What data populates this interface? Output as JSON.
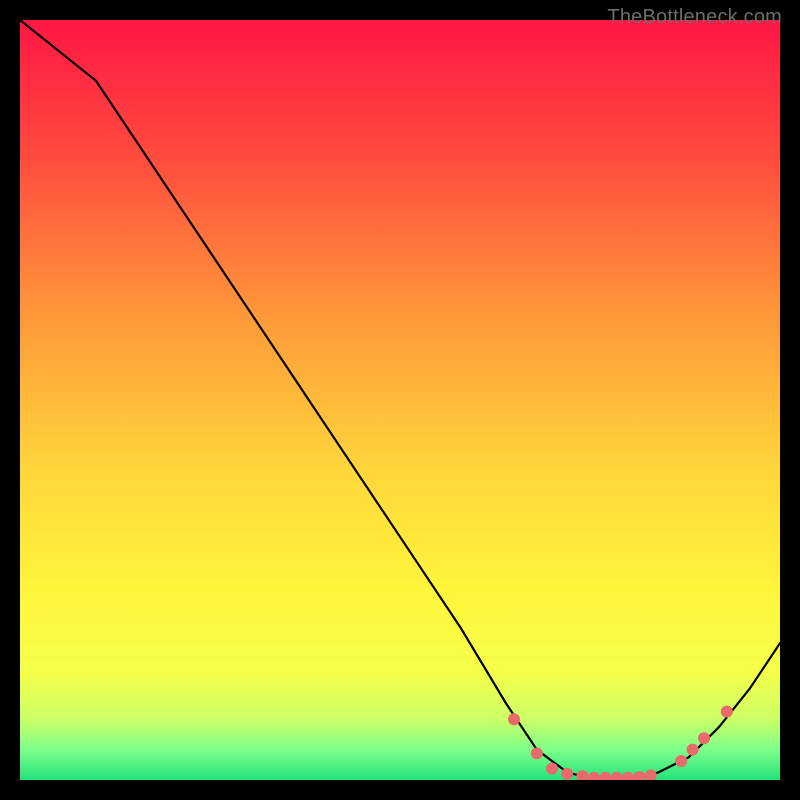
{
  "watermark": "TheBottleneck.com",
  "chart_data": {
    "type": "line",
    "title": "",
    "xlabel": "",
    "ylabel": "",
    "xlim": [
      0,
      100
    ],
    "ylim": [
      0,
      100
    ],
    "gradient_stops": [
      {
        "offset": 0,
        "color": "#ff1744"
      },
      {
        "offset": 18,
        "color": "#ff4b3e"
      },
      {
        "offset": 40,
        "color": "#ff9c3a"
      },
      {
        "offset": 60,
        "color": "#ffd83b"
      },
      {
        "offset": 75,
        "color": "#fff53b"
      },
      {
        "offset": 86,
        "color": "#f4ff4a"
      },
      {
        "offset": 92,
        "color": "#ccff66"
      },
      {
        "offset": 96,
        "color": "#7dff8a"
      },
      {
        "offset": 100,
        "color": "#23e27a"
      }
    ],
    "curve": [
      {
        "x": 0,
        "y": 100
      },
      {
        "x": 10,
        "y": 92
      },
      {
        "x": 20,
        "y": 77
      },
      {
        "x": 30,
        "y": 62
      },
      {
        "x": 40,
        "y": 47
      },
      {
        "x": 50,
        "y": 32
      },
      {
        "x": 58,
        "y": 20
      },
      {
        "x": 64,
        "y": 10
      },
      {
        "x": 68,
        "y": 4
      },
      {
        "x": 72,
        "y": 1
      },
      {
        "x": 76,
        "y": 0
      },
      {
        "x": 80,
        "y": 0
      },
      {
        "x": 84,
        "y": 1
      },
      {
        "x": 88,
        "y": 3
      },
      {
        "x": 92,
        "y": 7
      },
      {
        "x": 96,
        "y": 12
      },
      {
        "x": 100,
        "y": 18
      }
    ],
    "markers": [
      {
        "x": 65,
        "y": 8
      },
      {
        "x": 68,
        "y": 3.5
      },
      {
        "x": 70,
        "y": 1.5
      },
      {
        "x": 72,
        "y": 0.8
      },
      {
        "x": 74,
        "y": 0.5
      },
      {
        "x": 75.5,
        "y": 0.3
      },
      {
        "x": 77,
        "y": 0.3
      },
      {
        "x": 78.5,
        "y": 0.3
      },
      {
        "x": 80,
        "y": 0.3
      },
      {
        "x": 81.5,
        "y": 0.4
      },
      {
        "x": 83,
        "y": 0.6
      },
      {
        "x": 87,
        "y": 2.5
      },
      {
        "x": 88.5,
        "y": 4
      },
      {
        "x": 90,
        "y": 5.5
      },
      {
        "x": 93,
        "y": 9
      }
    ],
    "marker_color": "#e86a6a",
    "marker_radius": 6
  }
}
